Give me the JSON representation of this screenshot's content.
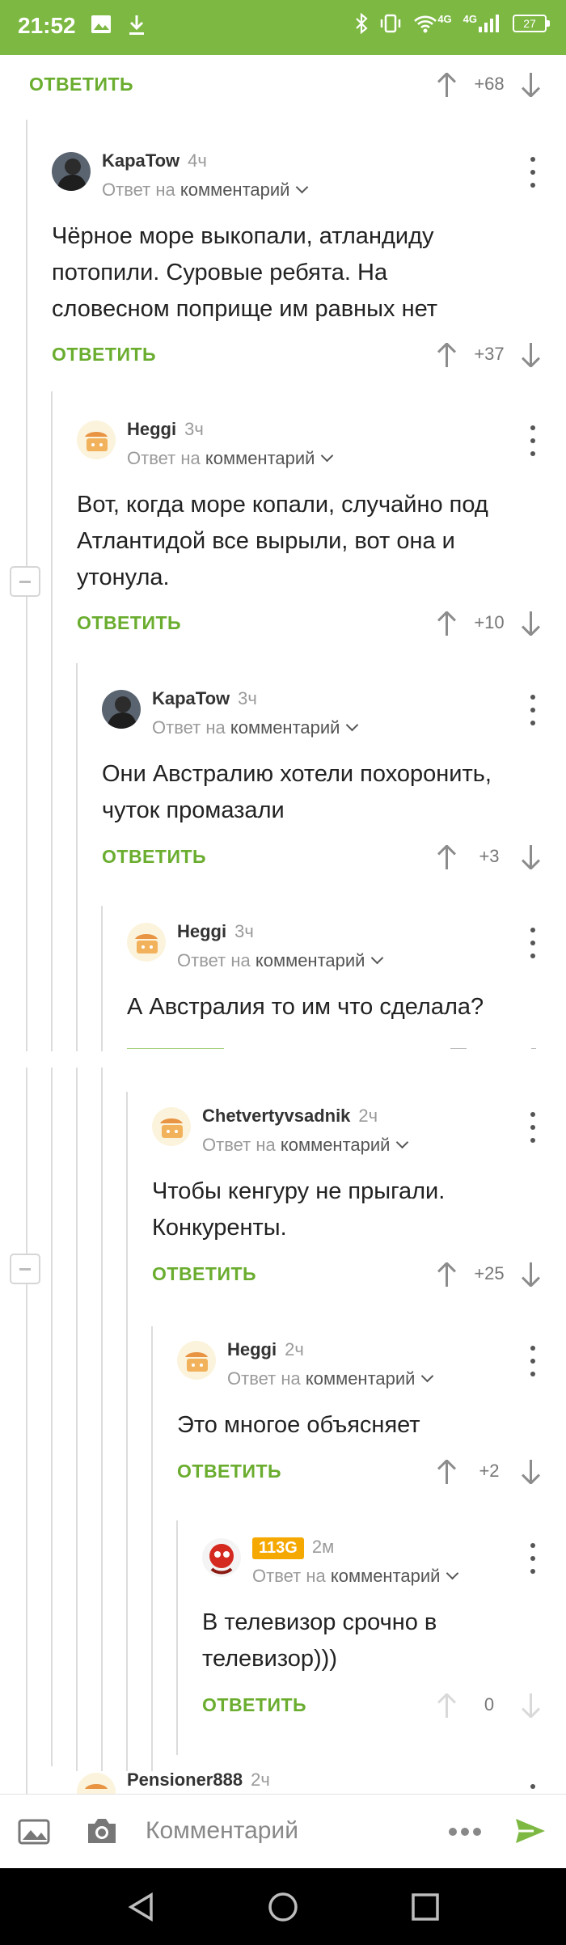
{
  "status_bar": {
    "time": "21:52",
    "network_label_1": "4G",
    "network_label_2": "4G",
    "battery": "27"
  },
  "top_item": {
    "reply_label": "ОТВЕТИТЬ",
    "score": "+68"
  },
  "comments": [
    {
      "author": "KapaTow",
      "age": "4ч",
      "reply_to_prefix": "Ответ на",
      "reply_to_link": "комментарий",
      "text_lines": [
        "Чёрное море выкопали, атландиду",
        "потопили. Суровые ребята. На",
        "словесном поприще им равных нет"
      ],
      "reply_label": "ОТВЕТИТЬ",
      "score": "+37"
    },
    {
      "author": "Heggi",
      "age": "3ч",
      "reply_to_prefix": "Ответ на",
      "reply_to_link": "комментарий",
      "text_lines": [
        "Вот, когда море копали, случайно под",
        "Атлантидой все вырыли, вот она и",
        "утонула."
      ],
      "reply_label": "ОТВЕТИТЬ",
      "score": "+10"
    },
    {
      "author": "KapaTow",
      "age": "3ч",
      "reply_to_prefix": "Ответ на",
      "reply_to_link": "комментарий",
      "text_lines": [
        "Они  Австралию хотели похоронить,",
        "чуток промазали"
      ],
      "reply_label": "ОТВЕТИТЬ",
      "score": "+3"
    },
    {
      "author": "Heggi",
      "age": "3ч",
      "reply_to_prefix": "Ответ на",
      "reply_to_link": "комментарий",
      "text_lines": [
        "А Австралия то им что сделала?"
      ],
      "reply_label": "",
      "score": ""
    },
    {
      "author": "Chetvertyvsadnik",
      "age": "2ч",
      "reply_to_prefix": "Ответ на",
      "reply_to_link": "комментарий",
      "text_lines": [
        "Чтобы кенгуру не прыгали.",
        "Конкуренты."
      ],
      "reply_label": "ОТВЕТИТЬ",
      "score": "+25"
    },
    {
      "author": "Heggi",
      "age": "2ч",
      "reply_to_prefix": "Ответ на",
      "reply_to_link": "комментарий",
      "text_lines": [
        "Это многое объясняет"
      ],
      "reply_label": "ОТВЕТИТЬ",
      "score": "+2"
    },
    {
      "author": "113G",
      "age": "2м",
      "reply_to_prefix": "Ответ на",
      "reply_to_link": "комментарий",
      "text_lines": [
        "В телевизор срочно в",
        "телевизор)))"
      ],
      "reply_label": "ОТВЕТИТЬ",
      "score": "0"
    },
    {
      "author": "Pensioner888",
      "age": "2ч"
    }
  ],
  "composer": {
    "placeholder": "Комментарий"
  },
  "colors": {
    "accent": "#7cb842",
    "link": "#6aad2f",
    "tag": "#f5a800"
  }
}
